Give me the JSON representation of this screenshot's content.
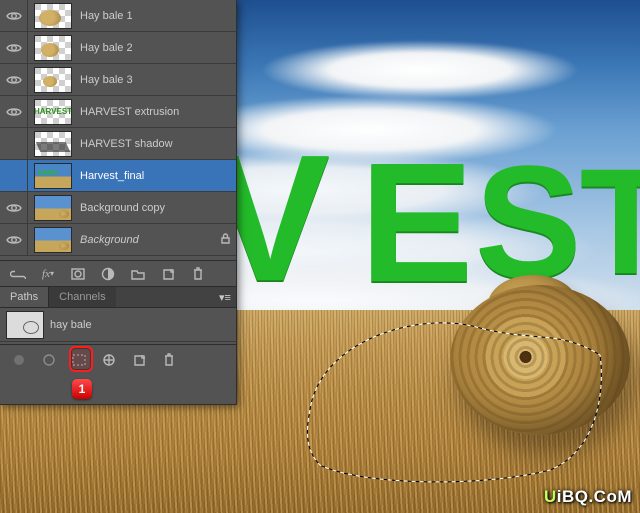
{
  "canvas": {
    "visible_text": "VEST",
    "text_color": "#24bb2a",
    "extrusion_color": "#0e3b12"
  },
  "layers": [
    {
      "name": "Hay bale 1",
      "visible": true,
      "selected": false,
      "locked": false
    },
    {
      "name": "Hay bale 2",
      "visible": true,
      "selected": false,
      "locked": false
    },
    {
      "name": "Hay bale 3",
      "visible": true,
      "selected": false,
      "locked": false
    },
    {
      "name": "HARVEST extrusion",
      "visible": true,
      "selected": false,
      "locked": false
    },
    {
      "name": "HARVEST shadow",
      "visible": false,
      "selected": false,
      "locked": false
    },
    {
      "name": "Harvest_final",
      "visible": false,
      "selected": true,
      "locked": false
    },
    {
      "name": "Background copy",
      "visible": true,
      "selected": false,
      "locked": false
    },
    {
      "name": "Background",
      "visible": true,
      "selected": false,
      "locked": true,
      "italic": true
    }
  ],
  "layersFooter": {
    "buttons": [
      "link-layers",
      "layer-fx",
      "add-mask",
      "adjustment-layer",
      "new-group",
      "new-layer",
      "delete-layer"
    ]
  },
  "pathsPanel": {
    "tabs": [
      "Paths",
      "Channels"
    ],
    "activeTab": "Paths",
    "paths": [
      {
        "name": "hay bale"
      }
    ],
    "footerButtons": [
      "fill-path",
      "stroke-path",
      "path-to-selection",
      "selection-to-path",
      "new-path",
      "delete-path"
    ]
  },
  "callouts": [
    {
      "label": "1",
      "target": "path-to-selection-button",
      "color": "#ff1d1d"
    }
  ],
  "watermark": {
    "part1": "U",
    "part2": "iBQ.CoM"
  }
}
